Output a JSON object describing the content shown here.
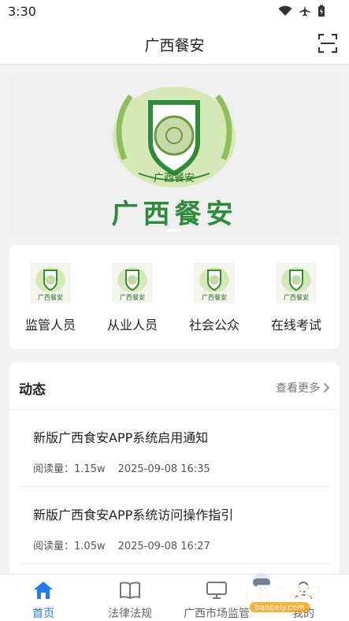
{
  "status_bar": {
    "time": "3:30"
  },
  "header": {
    "title": "广西餐安"
  },
  "banner": {
    "logo_text": "广西餐安",
    "badge_text": "广西餐安"
  },
  "quick_actions": [
    {
      "label": "监管人员",
      "badge": "广西餐安"
    },
    {
      "label": "从业人员",
      "badge": "广西餐安"
    },
    {
      "label": "社会公众",
      "badge": "广西餐安"
    },
    {
      "label": "在线考试",
      "badge": "广西餐安"
    }
  ],
  "news": {
    "title": "动态",
    "more": "查看更多",
    "items": [
      {
        "title": "新版广西食安APP系统启用通知",
        "reads_label": "阅读量：",
        "reads": "1.15w",
        "date": "2025-09-08 16:35"
      },
      {
        "title": "新版广西食安APP系统访问操作指引",
        "reads_label": "阅读量：",
        "reads": "1.05w",
        "date": "2025-09-08 16:27"
      }
    ]
  },
  "tabs": [
    {
      "label": "首页",
      "active": true
    },
    {
      "label": "法律法规"
    },
    {
      "label": "广西市场监管"
    },
    {
      "label": "我的"
    }
  ],
  "watermark": {
    "title": "宝贝游戏网",
    "url": "baobeiy.com"
  },
  "colors": {
    "accent": "#1c7cf4",
    "brand_green": "#2e8b3a"
  }
}
